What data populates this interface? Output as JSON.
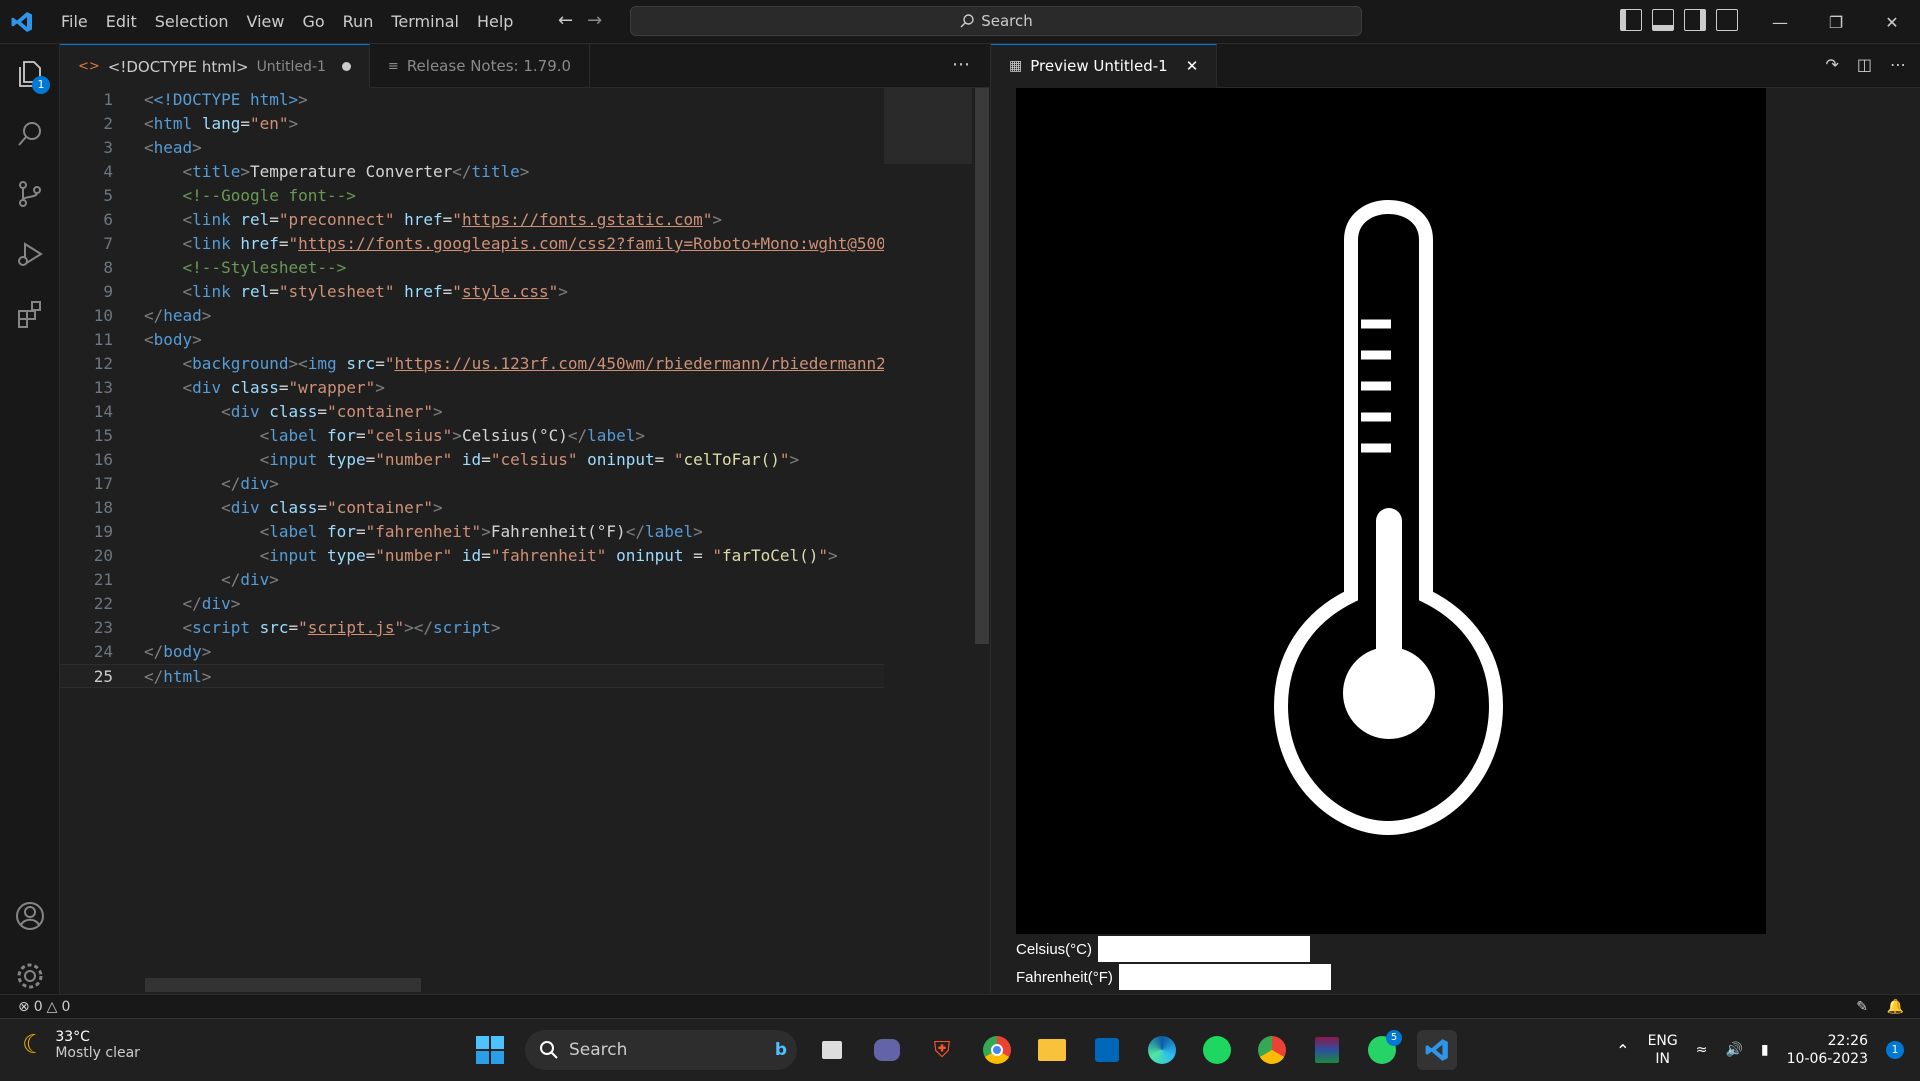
{
  "menu": [
    "File",
    "Edit",
    "Selection",
    "View",
    "Go",
    "Run",
    "Terminal",
    "Help"
  ],
  "search": {
    "label": "Search"
  },
  "tabs": [
    {
      "label": "<!DOCTYPE html>",
      "sub": "Untitled-1"
    },
    {
      "label": "Release Notes: 1.79.0"
    }
  ],
  "preview_tab": {
    "label": "Preview Untitled-1"
  },
  "activity_badge": "1",
  "code_lines": [
    {
      "n": "1"
    },
    {
      "n": "2"
    },
    {
      "n": "3"
    },
    {
      "n": "4"
    },
    {
      "n": "5"
    },
    {
      "n": "6"
    },
    {
      "n": "7"
    },
    {
      "n": "8"
    },
    {
      "n": "9"
    },
    {
      "n": "10"
    },
    {
      "n": "11"
    },
    {
      "n": "12"
    },
    {
      "n": "13"
    },
    {
      "n": "14"
    },
    {
      "n": "15"
    },
    {
      "n": "16"
    },
    {
      "n": "17"
    },
    {
      "n": "18"
    },
    {
      "n": "19"
    },
    {
      "n": "20"
    },
    {
      "n": "21"
    },
    {
      "n": "22"
    },
    {
      "n": "23"
    },
    {
      "n": "24"
    },
    {
      "n": "25"
    }
  ],
  "code_text": {
    "l1": "<!DOCTYPE html>",
    "l4_title": "Temperature Converter",
    "l5": "<!--Google font-->",
    "l6_url": "https://fonts.gstatic.com",
    "l7_url": "https://fonts.googleapis.com/css2?family=Roboto+Mono:wght@500",
    "l8": "<!--Stylesheet-->",
    "l9_css": "style.css",
    "l12_url": "https://us.123rf.com/450wm/rbiedermann/rbiedermann2",
    "l15_text": "Celsius(°C)",
    "l16_fn": "celToFar()",
    "l19_text": "Fahrenheit(°F)",
    "l20_fn": "farToCel()",
    "l23_js": "script.js"
  },
  "preview": {
    "celsius_label": "Celsius(°C)",
    "fahrenheit_label": "Fahrenheit(°F)",
    "celsius_value": "",
    "fahrenheit_value": ""
  },
  "status": {
    "errors": "0",
    "warnings": "0"
  },
  "taskbar": {
    "temperature": "33°C",
    "weather": "Mostly clear",
    "search": "Search",
    "whatsapp_badge": "5",
    "lang": "ENG",
    "region": "IN",
    "time": "22:26",
    "date": "10-06-2023",
    "notif": "1"
  }
}
